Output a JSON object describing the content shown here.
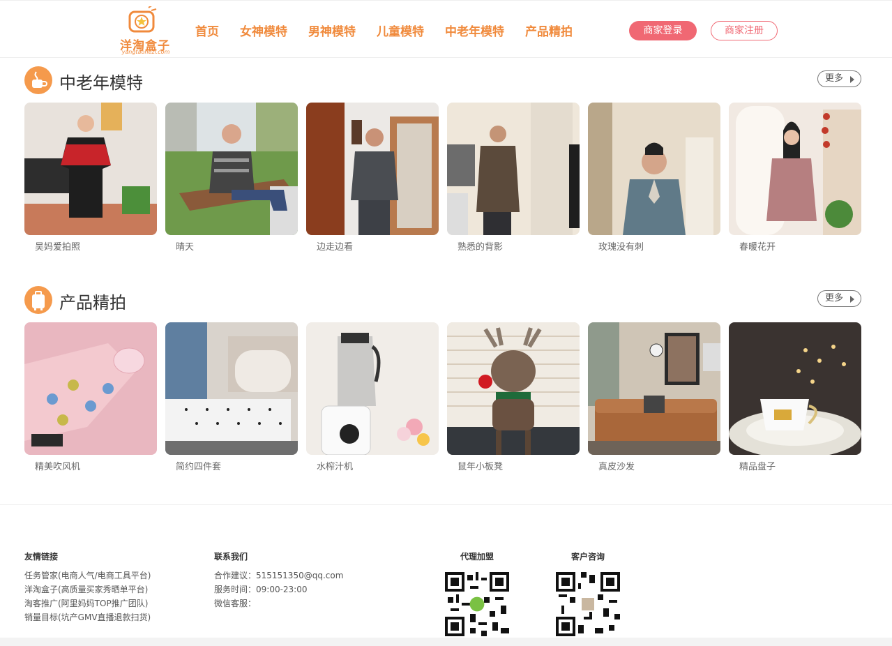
{
  "brand": {
    "name": "洋淘盒子",
    "domain": "yangtaohezi.com",
    "accent": "#f08a3c",
    "pink": "#f06873"
  },
  "nav": [
    {
      "label": "首页"
    },
    {
      "label": "女神模特"
    },
    {
      "label": "男神模特"
    },
    {
      "label": "儿童模特"
    },
    {
      "label": "中老年模特"
    },
    {
      "label": "产品精拍"
    }
  ],
  "auth": {
    "login": "商家登录",
    "register": "商家注册"
  },
  "sections": [
    {
      "title": "中老年模特",
      "icon": "coffee-cup-icon",
      "more": "更多",
      "items": [
        {
          "caption": "吴妈爱拍照",
          "photo": "woman-red-jacket-photo"
        },
        {
          "caption": "晴天",
          "photo": "man-on-bench-photo"
        },
        {
          "caption": "边走边看",
          "photo": "man-grey-sweater-photo"
        },
        {
          "caption": "熟悉的背影",
          "photo": "man-brown-coat-photo"
        },
        {
          "caption": "玫瑰没有刺",
          "photo": "woman-grey-cardigan-photo"
        },
        {
          "caption": "春暖花开",
          "photo": "woman-pink-jacket-photo"
        }
      ]
    },
    {
      "title": "产品精拍",
      "icon": "suitcase-icon",
      "more": "更多",
      "items": [
        {
          "caption": "精美吹风机",
          "photo": "hair-dryer-photo"
        },
        {
          "caption": "简约四件套",
          "photo": "bedding-set-photo"
        },
        {
          "caption": "水榨汁机",
          "photo": "juicer-photo"
        },
        {
          "caption": "鼠年小板凳",
          "photo": "reindeer-stool-photo"
        },
        {
          "caption": "真皮沙发",
          "photo": "leather-sofa-photo"
        },
        {
          "caption": "精品盘子",
          "photo": "teacup-plate-photo"
        }
      ]
    }
  ],
  "footer": {
    "links": {
      "title": "友情链接",
      "items": [
        "任务管家(电商人气/电商工具平台)",
        "洋淘盒子(高质量买家秀晒单平台)",
        "淘客推广(阿里妈妈TOP推广团队)",
        "销量目标(坑产GMV直播退款扫货)"
      ]
    },
    "contact": {
      "title": "联系我们",
      "items": [
        "合作建议：515151350@qq.com",
        "服务时间：09:00-23:00",
        "微信客服："
      ]
    },
    "agent": {
      "title": "代理加盟"
    },
    "support": {
      "title": "客户咨询"
    }
  }
}
